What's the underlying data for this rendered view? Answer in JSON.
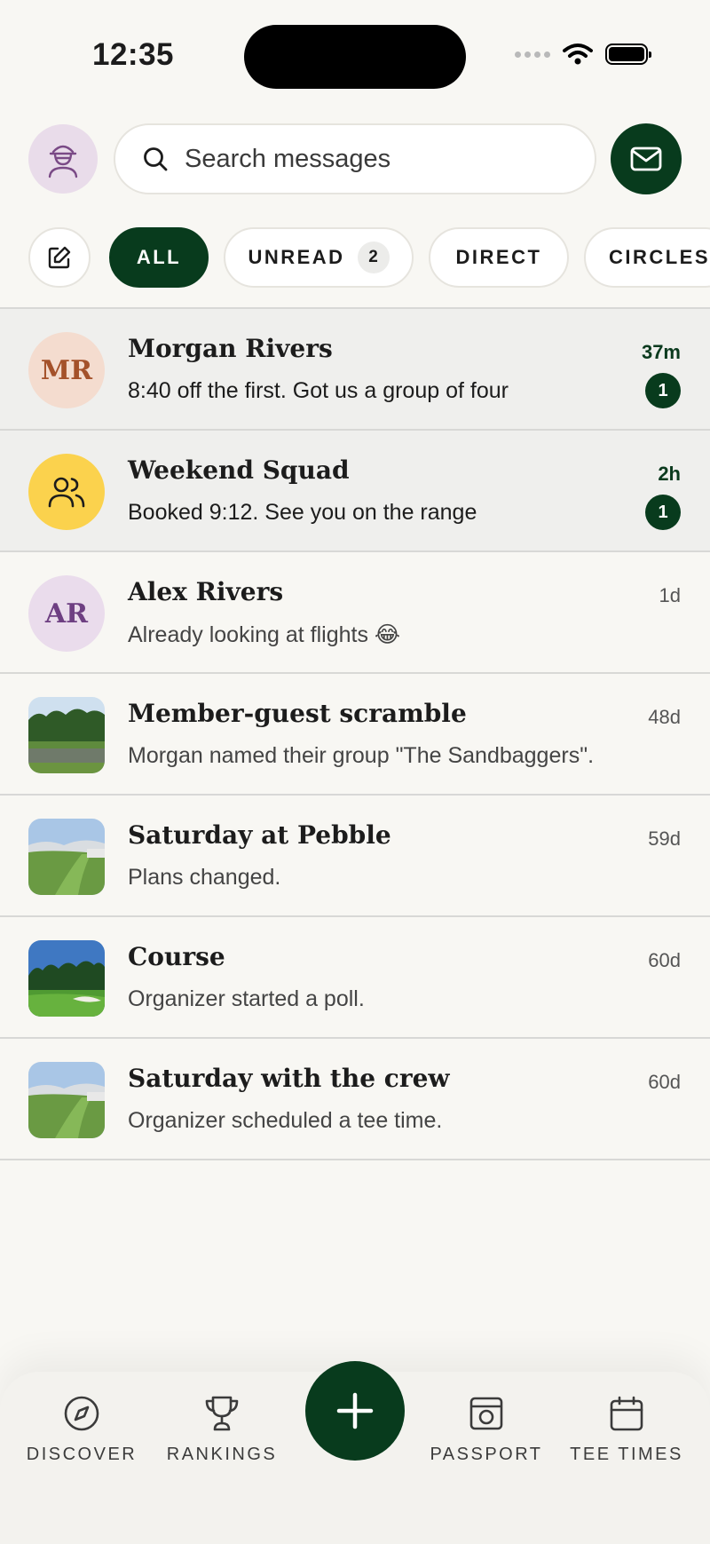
{
  "status_bar": {
    "time": "12:35"
  },
  "header": {
    "search_placeholder": "Search messages"
  },
  "filters": [
    {
      "label": "ALL",
      "active": true
    },
    {
      "label": "UNREAD",
      "count": "2"
    },
    {
      "label": "DIRECT"
    },
    {
      "label": "CIRCLES"
    }
  ],
  "conversations": [
    {
      "name": "Morgan Rivers",
      "initials": "MR",
      "preview": "8:40 off the first. Got us a group of four",
      "time": "37m",
      "unread": "1"
    },
    {
      "name": "Weekend Squad",
      "icon": "group-icon",
      "preview": "Booked 9:12. See you on the range",
      "time": "2h",
      "unread": "1"
    },
    {
      "name": "Alex Rivers",
      "initials": "AR",
      "preview": "Already looking at flights 😂",
      "time": "1d"
    },
    {
      "name": "Member-guest scramble",
      "preview": "Morgan named their group \"The Sandbaggers\".",
      "time": "48d"
    },
    {
      "name": "Saturday at Pebble",
      "preview": "Plans changed.",
      "time": "59d"
    },
    {
      "name": "Course",
      "preview": "Organizer started a poll.",
      "time": "60d"
    },
    {
      "name": "Saturday with the crew",
      "preview": "Organizer scheduled a tee time.",
      "time": "60d"
    }
  ],
  "tabbar": {
    "discover": "DISCOVER",
    "rankings": "RANKINGS",
    "passport": "PASSPORT",
    "tee_times": "TEE TIMES"
  },
  "colors": {
    "brand_green": "#083b1d",
    "background": "#f8f7f3",
    "unread_row": "#efefed"
  }
}
